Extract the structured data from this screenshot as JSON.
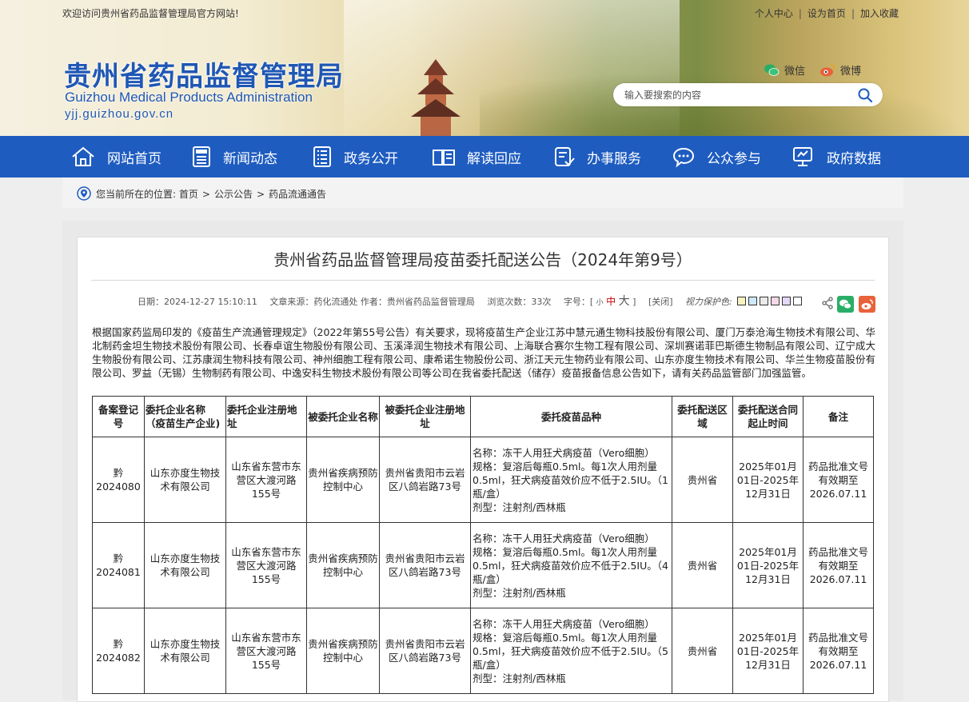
{
  "topbar": {
    "welcome": "欢迎访问贵州省药品监督管理局官方网站!",
    "links": [
      "个人中心",
      "设为首页",
      "加入收藏"
    ]
  },
  "logo": {
    "cn": "贵州省药品监督管理局",
    "en": "Guizhou Medical Products Administration",
    "url": "yjj.guizhou.gov.cn"
  },
  "social": {
    "wechat": "微信",
    "weibo": "微博"
  },
  "search": {
    "placeholder": "输入要搜索的内容"
  },
  "nav": [
    {
      "label": "网站首页",
      "icon": "home-icon"
    },
    {
      "label": "新闻动态",
      "icon": "news-icon"
    },
    {
      "label": "政务公开",
      "icon": "document-list-icon"
    },
    {
      "label": "解读回应",
      "icon": "book-icon"
    },
    {
      "label": "办事服务",
      "icon": "service-icon"
    },
    {
      "label": "公众参与",
      "icon": "chat-icon"
    },
    {
      "label": "政府数据",
      "icon": "data-screen-icon"
    }
  ],
  "breadcrumb": {
    "prefix": "您当前所在的位置:",
    "items": [
      "首页",
      "公示公告",
      "药品流通通告"
    ]
  },
  "article": {
    "title": "贵州省药品监督管理局疫苗委托配送公告（2024年第9号）",
    "meta": {
      "date": "日期：2024-12-27 15:10:11",
      "source": "文章来源：药化流通处",
      "author": "作者：贵州省药品监督管理局",
      "views": "浏览次数：33次",
      "font_label": "字号：[",
      "font_small": "小",
      "font_mid": "中",
      "font_large": "大",
      "font_close": "]",
      "close": "[关闭]",
      "eye_label": "视力保护色:"
    },
    "eye_colors": [
      "#fbf2c4",
      "#cde8f7",
      "#e9e9e9",
      "#f4d8e6",
      "#e4d7f7",
      "#ffffff"
    ],
    "intro": "根据国家药监局印发的《疫苗生产流通管理规定》（2022年第55号公告）有关要求，现将疫苗生产企业江苏中慧元通生物科技股份有限公司、厦门万泰沧海生物技术有限公司、华北制药金坦生物技术股份有限公司、长春卓谊生物股份有限公司、玉溪泽润生物技术有限公司、上海联合赛尔生物工程有限公司、深圳赛诺菲巴斯德生物制品有限公司、辽宁成大生物股份有限公司、江苏康润生物科技有限公司、神州细胞工程有限公司、康希诺生物股份公司、浙江天元生物药业有限公司、山东亦度生物技术有限公司、华兰生物疫苗股份有限公司、罗益（无锡）生物制药有限公司、中逸安科生物技术股份有限公司等公司在我省委托配送（储存）疫苗报备信息公告如下，请有关药品监管部门加强监管。",
    "table": {
      "headers": [
        "备案登记号",
        "委托企业名称（疫苗生产企业)",
        "委托企业注册地址",
        "被委托企业名称",
        "被委托企业注册地址",
        "委托疫苗品种",
        "委托配送区域",
        "委托配送合同起止时间",
        "备注"
      ],
      "rows": [
        {
          "no": "黔2024080",
          "company": "山东亦度生物技术有限公司",
          "address": "山东省东营市东营区大渡河路155号",
          "agent": "贵州省疾病预防控制中心",
          "agent_address": "贵州省贵阳市云岩区八鸽岩路73号",
          "vaccine": [
            "名称：冻干人用狂犬病疫苗（Vero细胞）",
            "规格：复溶后每瓶0.5ml。每1次人用剂量0.5ml，狂犬病疫苗效价应不低于2.5IU。（1瓶/盒）",
            "剂型：注射剂/西林瓶"
          ],
          "region": "贵州省",
          "period": "2025年01月01日-2025年12月31日",
          "remark": "药品批准文号有效期至2026.07.11"
        },
        {
          "no": "黔2024081",
          "company": "山东亦度生物技术有限公司",
          "address": "山东省东营市东营区大渡河路155号",
          "agent": "贵州省疾病预防控制中心",
          "agent_address": "贵州省贵阳市云岩区八鸽岩路73号",
          "vaccine": [
            "名称：冻干人用狂犬病疫苗（Vero细胞）",
            "规格：复溶后每瓶0.5ml。每1次人用剂量0.5ml，狂犬病疫苗效价应不低于2.5IU。（4瓶/盒）",
            "剂型：注射剂/西林瓶"
          ],
          "region": "贵州省",
          "period": "2025年01月01日-2025年12月31日",
          "remark": "药品批准文号有效期至2026.07.11"
        },
        {
          "no": "黔2024082",
          "company": "山东亦度生物技术有限公司",
          "address": "山东省东营市东营区大渡河路155号",
          "agent": "贵州省疾病预防控制中心",
          "agent_address": "贵州省贵阳市云岩区八鸽岩路73号",
          "vaccine": [
            "名称：冻干人用狂犬病疫苗（Vero细胞）",
            "规格：复溶后每瓶0.5ml。每1次人用剂量0.5ml，狂犬病疫苗效价应不低于2.5IU。（5瓶/盒）",
            "剂型：注射剂/西林瓶"
          ],
          "region": "贵州省",
          "period": "2025年01月01日-2025年12月31日",
          "remark": "药品批准文号有效期至2026.07.11"
        }
      ]
    }
  },
  "colors": {
    "nav_bg": "#1e5cc0",
    "logo_blue": "#1f57b4",
    "wechat_green": "#2aae67",
    "weibo_orange": "#e8623b"
  }
}
